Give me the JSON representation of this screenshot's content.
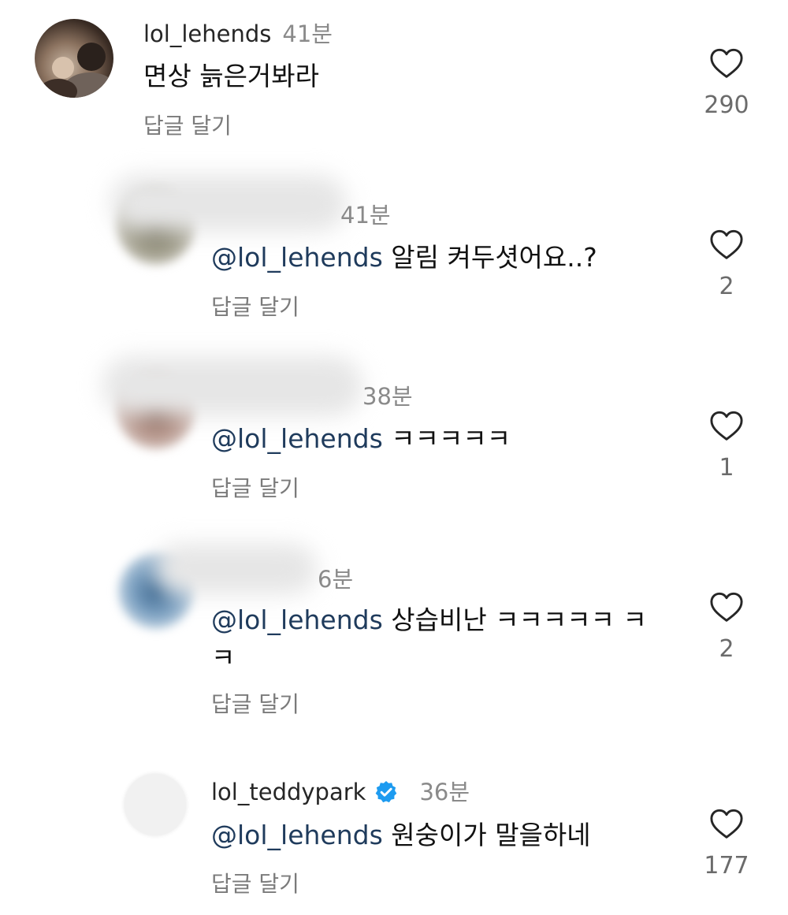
{
  "comments": [
    {
      "username": "lol_lehends",
      "time": "41분",
      "mention": "",
      "text": "면상 늙은거봐라",
      "reply_label": "답글 달기",
      "likes": "290"
    },
    {
      "username": "",
      "time": "41분",
      "mention": "@lol_lehends",
      "text": " 알림 켜두셧어요..?",
      "reply_label": "답글 달기",
      "likes": "2"
    },
    {
      "username": "",
      "time": "38분",
      "mention": "@lol_lehends",
      "text": " ㅋㅋㅋㅋㅋ",
      "reply_label": "답글 달기",
      "likes": "1"
    },
    {
      "username": "",
      "time": "6분",
      "mention": "@lol_lehends",
      "text": " 상습비난 ㅋㅋㅋㅋㅋ ㅋㅋ",
      "reply_label": "답글 달기",
      "likes": "2"
    },
    {
      "username": "lol_teddypark",
      "time": "36분",
      "mention": "@lol_lehends",
      "text": " 원숭이가 말을하네",
      "reply_label": "답글 달기",
      "likes": "177"
    }
  ],
  "colors": {
    "mention": "#1f3b5c",
    "verified": "#1d9bf0",
    "secondary_text": "#7b7b7b"
  },
  "icons": {
    "like": "heart-outline-icon",
    "verified": "verified-badge-icon"
  }
}
